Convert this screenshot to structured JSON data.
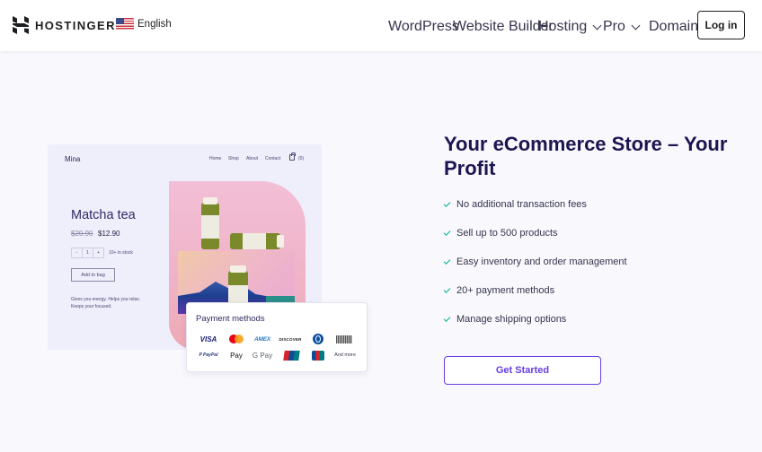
{
  "header": {
    "brand": "HOSTINGER",
    "language": "English",
    "language_flag": "us-flag-icon",
    "nav": [
      {
        "label": "WordPress",
        "dropdown": false
      },
      {
        "label": "Website Builder",
        "dropdown": false
      },
      {
        "label": "Hosting",
        "dropdown": true
      },
      {
        "label": "Pro",
        "dropdown": true
      },
      {
        "label": "Domains",
        "dropdown": false
      }
    ],
    "login_label": "Log in"
  },
  "mockup": {
    "store_name": "Mina",
    "nav": [
      "Home",
      "Shop",
      "About",
      "Contact"
    ],
    "cart_count": "(0)",
    "product_title": "Matcha tea",
    "price_old": "$20.90",
    "price_new": "$12.90",
    "qty_minus": "-",
    "qty_value": "1",
    "qty_plus": "+",
    "stock": "10+ in stock",
    "add_to_bag": "Add to bag",
    "description": "Gives you energy. Helps you relax. Keeps your focused."
  },
  "payment_card": {
    "title": "Payment methods",
    "methods_row1": [
      "VISA",
      "Mastercard",
      "AMEX",
      "DISCOVER",
      "Diners Club",
      "Boleto"
    ],
    "methods_row2": [
      "PayPal",
      "Apple Pay",
      "G Pay",
      "UnionPay",
      "JCB",
      "And more"
    ],
    "labels": {
      "visa": "VISA",
      "amex": "AMEX",
      "discover": "DISCOVER",
      "paypal": "P PayPal",
      "apay": " Pay",
      "gpay": "G Pay",
      "more": "And more"
    }
  },
  "hero": {
    "headline": "Your eCommerce Store – Your Profit",
    "features": [
      "No additional transaction fees",
      "Sell up to 500 products",
      "Easy inventory and order management",
      "20+ payment methods",
      "Manage shipping options"
    ],
    "cta_label": "Get Started"
  },
  "colors": {
    "accent": "#673de6",
    "headline": "#1d1550",
    "check": "#00b090",
    "page_bg": "#f8f8fd"
  }
}
